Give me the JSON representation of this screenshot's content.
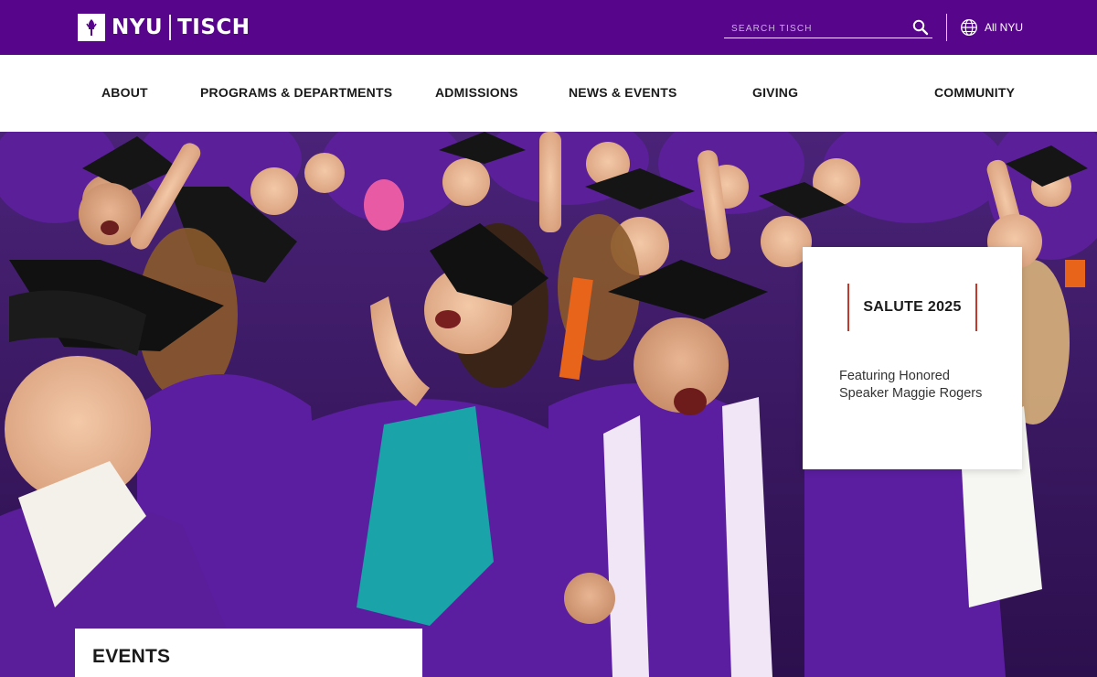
{
  "brand": {
    "left": "NYU",
    "right": "TISCH",
    "color": "#57068c",
    "accent": "#c0392b"
  },
  "search": {
    "placeholder": "SEARCH TISCH",
    "icon": "search-icon"
  },
  "allnyu": {
    "label": "All NYU",
    "icon": "globe-icon"
  },
  "nav": {
    "items": [
      {
        "label": "ABOUT"
      },
      {
        "label": "PROGRAMS & DEPARTMENTS"
      },
      {
        "label": "ADMISSIONS"
      },
      {
        "label": "NEWS & EVENTS"
      },
      {
        "label": "GIVING"
      },
      {
        "label": "COMMUNITY"
      }
    ]
  },
  "hero": {
    "image": "graduates-celebrating-photo",
    "feature": {
      "title": "SALUTE 2025",
      "subtitle": "Featuring Honored Speaker Maggie Rogers"
    }
  },
  "events": {
    "title": "EVENTS"
  }
}
